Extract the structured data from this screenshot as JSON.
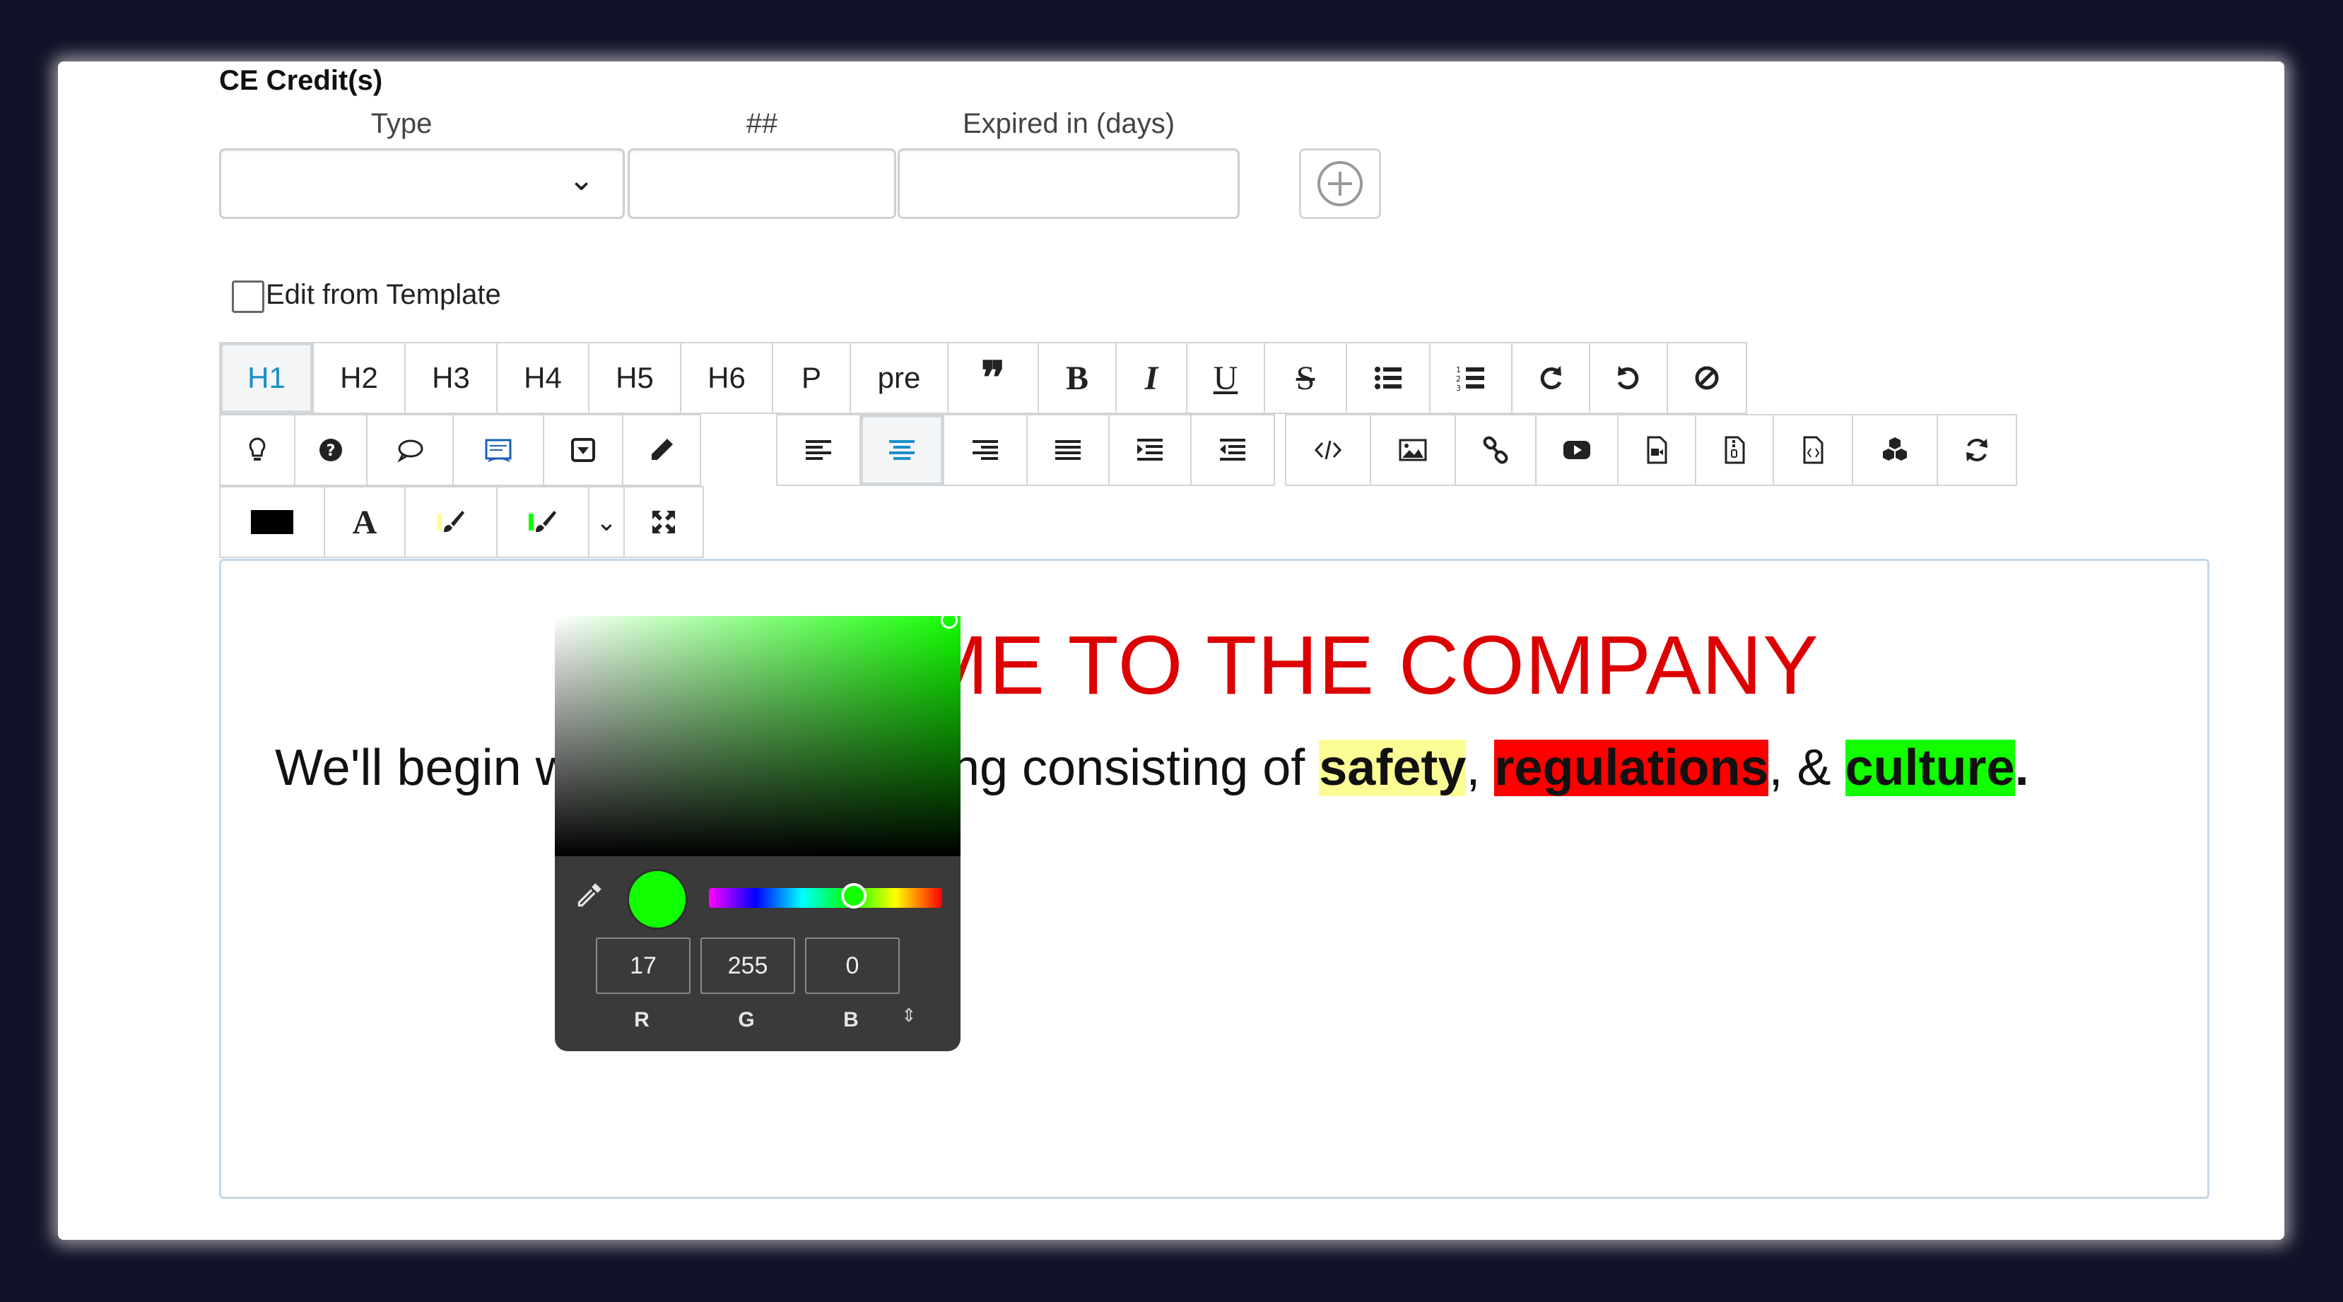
{
  "ce_credits": {
    "title": "CE Credit(s)",
    "type_label": "Type",
    "type_value": "",
    "count_label": "##",
    "count_value": "",
    "expired_label": "Expired in (days)",
    "expired_value": ""
  },
  "template_checkbox": {
    "label": "Edit from Template",
    "checked": false
  },
  "toolbar": {
    "row1": [
      "H1",
      "H2",
      "H3",
      "H4",
      "H5",
      "H6",
      "P",
      "pre",
      "❞"
    ],
    "active_format": "H1",
    "row1b": {
      "bold": "B",
      "italic": "I",
      "underline": "U",
      "strike": "S"
    },
    "font_color_letter": "A"
  },
  "editor": {
    "heading": "WELCOME TO THE COMPANY",
    "para_prefix": "We'll begin with your onboarding consisting of ",
    "word1": "safety",
    "sep1": ", ",
    "word2": "regulations",
    "sep2": ", & ",
    "word3": "culture",
    "end": "."
  },
  "color_picker": {
    "color": "#11ff00",
    "r": "17",
    "g": "255",
    "b": "0",
    "r_label": "R",
    "g_label": "G",
    "b_label": "B"
  },
  "colors": {
    "heading": "#dd0000",
    "highlight_yellow": "#fdfd96",
    "highlight_red": "#ff0000",
    "highlight_green": "#11ff00",
    "active_accent": "#1a8fc9"
  }
}
